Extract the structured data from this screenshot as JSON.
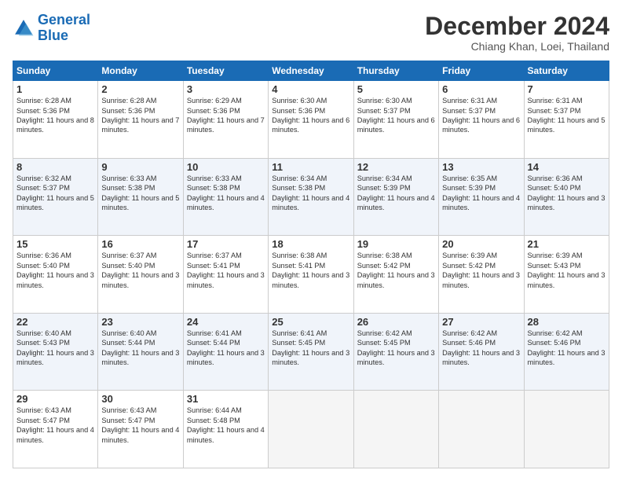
{
  "header": {
    "logo_general": "General",
    "logo_blue": "Blue",
    "month": "December 2024",
    "location": "Chiang Khan, Loei, Thailand"
  },
  "weekdays": [
    "Sunday",
    "Monday",
    "Tuesday",
    "Wednesday",
    "Thursday",
    "Friday",
    "Saturday"
  ],
  "weeks": [
    [
      {
        "day": "1",
        "sunrise": "6:28 AM",
        "sunset": "5:36 PM",
        "daylight": "11 hours and 8 minutes."
      },
      {
        "day": "2",
        "sunrise": "6:28 AM",
        "sunset": "5:36 PM",
        "daylight": "11 hours and 7 minutes."
      },
      {
        "day": "3",
        "sunrise": "6:29 AM",
        "sunset": "5:36 PM",
        "daylight": "11 hours and 7 minutes."
      },
      {
        "day": "4",
        "sunrise": "6:30 AM",
        "sunset": "5:36 PM",
        "daylight": "11 hours and 6 minutes."
      },
      {
        "day": "5",
        "sunrise": "6:30 AM",
        "sunset": "5:37 PM",
        "daylight": "11 hours and 6 minutes."
      },
      {
        "day": "6",
        "sunrise": "6:31 AM",
        "sunset": "5:37 PM",
        "daylight": "11 hours and 6 minutes."
      },
      {
        "day": "7",
        "sunrise": "6:31 AM",
        "sunset": "5:37 PM",
        "daylight": "11 hours and 5 minutes."
      }
    ],
    [
      {
        "day": "8",
        "sunrise": "6:32 AM",
        "sunset": "5:37 PM",
        "daylight": "11 hours and 5 minutes."
      },
      {
        "day": "9",
        "sunrise": "6:33 AM",
        "sunset": "5:38 PM",
        "daylight": "11 hours and 5 minutes."
      },
      {
        "day": "10",
        "sunrise": "6:33 AM",
        "sunset": "5:38 PM",
        "daylight": "11 hours and 4 minutes."
      },
      {
        "day": "11",
        "sunrise": "6:34 AM",
        "sunset": "5:38 PM",
        "daylight": "11 hours and 4 minutes."
      },
      {
        "day": "12",
        "sunrise": "6:34 AM",
        "sunset": "5:39 PM",
        "daylight": "11 hours and 4 minutes."
      },
      {
        "day": "13",
        "sunrise": "6:35 AM",
        "sunset": "5:39 PM",
        "daylight": "11 hours and 4 minutes."
      },
      {
        "day": "14",
        "sunrise": "6:36 AM",
        "sunset": "5:40 PM",
        "daylight": "11 hours and 3 minutes."
      }
    ],
    [
      {
        "day": "15",
        "sunrise": "6:36 AM",
        "sunset": "5:40 PM",
        "daylight": "11 hours and 3 minutes."
      },
      {
        "day": "16",
        "sunrise": "6:37 AM",
        "sunset": "5:40 PM",
        "daylight": "11 hours and 3 minutes."
      },
      {
        "day": "17",
        "sunrise": "6:37 AM",
        "sunset": "5:41 PM",
        "daylight": "11 hours and 3 minutes."
      },
      {
        "day": "18",
        "sunrise": "6:38 AM",
        "sunset": "5:41 PM",
        "daylight": "11 hours and 3 minutes."
      },
      {
        "day": "19",
        "sunrise": "6:38 AM",
        "sunset": "5:42 PM",
        "daylight": "11 hours and 3 minutes."
      },
      {
        "day": "20",
        "sunrise": "6:39 AM",
        "sunset": "5:42 PM",
        "daylight": "11 hours and 3 minutes."
      },
      {
        "day": "21",
        "sunrise": "6:39 AM",
        "sunset": "5:43 PM",
        "daylight": "11 hours and 3 minutes."
      }
    ],
    [
      {
        "day": "22",
        "sunrise": "6:40 AM",
        "sunset": "5:43 PM",
        "daylight": "11 hours and 3 minutes."
      },
      {
        "day": "23",
        "sunrise": "6:40 AM",
        "sunset": "5:44 PM",
        "daylight": "11 hours and 3 minutes."
      },
      {
        "day": "24",
        "sunrise": "6:41 AM",
        "sunset": "5:44 PM",
        "daylight": "11 hours and 3 minutes."
      },
      {
        "day": "25",
        "sunrise": "6:41 AM",
        "sunset": "5:45 PM",
        "daylight": "11 hours and 3 minutes."
      },
      {
        "day": "26",
        "sunrise": "6:42 AM",
        "sunset": "5:45 PM",
        "daylight": "11 hours and 3 minutes."
      },
      {
        "day": "27",
        "sunrise": "6:42 AM",
        "sunset": "5:46 PM",
        "daylight": "11 hours and 3 minutes."
      },
      {
        "day": "28",
        "sunrise": "6:42 AM",
        "sunset": "5:46 PM",
        "daylight": "11 hours and 3 minutes."
      }
    ],
    [
      {
        "day": "29",
        "sunrise": "6:43 AM",
        "sunset": "5:47 PM",
        "daylight": "11 hours and 4 minutes."
      },
      {
        "day": "30",
        "sunrise": "6:43 AM",
        "sunset": "5:47 PM",
        "daylight": "11 hours and 4 minutes."
      },
      {
        "day": "31",
        "sunrise": "6:44 AM",
        "sunset": "5:48 PM",
        "daylight": "11 hours and 4 minutes."
      },
      null,
      null,
      null,
      null
    ]
  ]
}
